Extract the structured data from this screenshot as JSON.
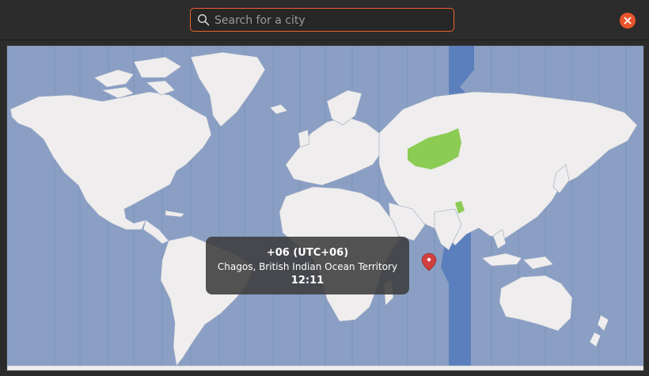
{
  "search": {
    "placeholder": "Search for a city"
  },
  "colors": {
    "ocean": "#8a9fc3",
    "land": "#efeded",
    "selected_zone_band": "#5b7fbd",
    "selected_region": "#8ccc55",
    "accent": "#e9642a",
    "close_button": "#e9542a"
  },
  "tooltip": {
    "timezone": "+06 (UTC+06)",
    "location": "Chagos, British Indian Ocean Territory",
    "time": "12:11"
  },
  "icons": {
    "search": "search-icon",
    "close": "close-icon",
    "pin": "map-pin-icon"
  }
}
